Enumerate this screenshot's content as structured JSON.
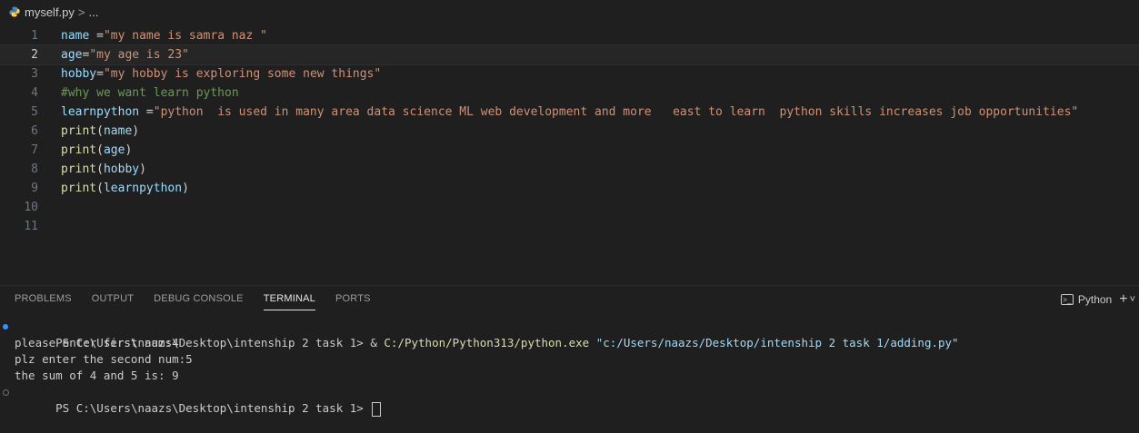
{
  "breadcrumb": {
    "file": "myself.py",
    "separator": ">",
    "rest": "..."
  },
  "editor": {
    "current_line": 2,
    "lines": [
      {
        "n": "1",
        "parts": [
          [
            "var",
            "name"
          ],
          [
            "pun",
            " ="
          ],
          [
            "str",
            "\"my name is samra naz \""
          ]
        ]
      },
      {
        "n": "2",
        "parts": [
          [
            "var",
            "age"
          ],
          [
            "pun",
            "="
          ],
          [
            "str",
            "\"my age is 23\""
          ]
        ]
      },
      {
        "n": "3",
        "parts": [
          [
            "var",
            "hobby"
          ],
          [
            "pun",
            "="
          ],
          [
            "str",
            "\"my hobby is exploring some new things\""
          ]
        ]
      },
      {
        "n": "4",
        "parts": [
          [
            "cmt",
            "#why we want learn python"
          ]
        ]
      },
      {
        "n": "5",
        "parts": [
          [
            "var",
            "learnpython"
          ],
          [
            "pun",
            " ="
          ],
          [
            "str",
            "\"python  is used in many area data science ML web development and more   east to learn  python skills increases job opportunities\""
          ]
        ]
      },
      {
        "n": "6",
        "parts": [
          [
            "fn",
            "print"
          ],
          [
            "pun",
            "("
          ],
          [
            "var",
            "name"
          ],
          [
            "pun",
            ")"
          ]
        ]
      },
      {
        "n": "7",
        "parts": [
          [
            "fn",
            "print"
          ],
          [
            "pun",
            "("
          ],
          [
            "var",
            "age"
          ],
          [
            "pun",
            ")"
          ]
        ]
      },
      {
        "n": "8",
        "parts": [
          [
            "fn",
            "print"
          ],
          [
            "pun",
            "("
          ],
          [
            "var",
            "hobby"
          ],
          [
            "pun",
            ")"
          ]
        ]
      },
      {
        "n": "9",
        "parts": [
          [
            "fn",
            "print"
          ],
          [
            "pun",
            "("
          ],
          [
            "var",
            "learnpython"
          ],
          [
            "pun",
            ")"
          ]
        ]
      },
      {
        "n": "10",
        "parts": []
      },
      {
        "n": "11",
        "parts": []
      }
    ]
  },
  "panel": {
    "tabs": [
      {
        "label": "PROBLEMS",
        "active": false
      },
      {
        "label": "OUTPUT",
        "active": false
      },
      {
        "label": "DEBUG CONSOLE",
        "active": false
      },
      {
        "label": "TERMINAL",
        "active": true
      },
      {
        "label": "PORTS",
        "active": false
      }
    ],
    "shell_label": "Python",
    "plus": "+",
    "chevron": "˅"
  },
  "terminal": {
    "prompt": "PS C:\\Users\\naazs\\Desktop\\intenship 2 task 1> ",
    "cmd_amp": "& ",
    "cmd_exe": "C:/Python/Python313/python.exe",
    "cmd_arg": " \"c:/Users/naazs/Desktop/intenship 2 task 1/adding.py\"",
    "output": [
      "please enter first num:4",
      "plz enter the second num:5",
      "the sum of 4 and 5 is: 9"
    ],
    "final_prompt": "PS C:\\Users\\naazs\\Desktop\\intenship 2 task 1> "
  },
  "colors": {
    "background": "#1f1f1f",
    "keyword_var": "#9cdcfe",
    "string": "#ce9178",
    "comment": "#6a9955",
    "function": "#dcdcaa",
    "accent": "#3794ff"
  }
}
